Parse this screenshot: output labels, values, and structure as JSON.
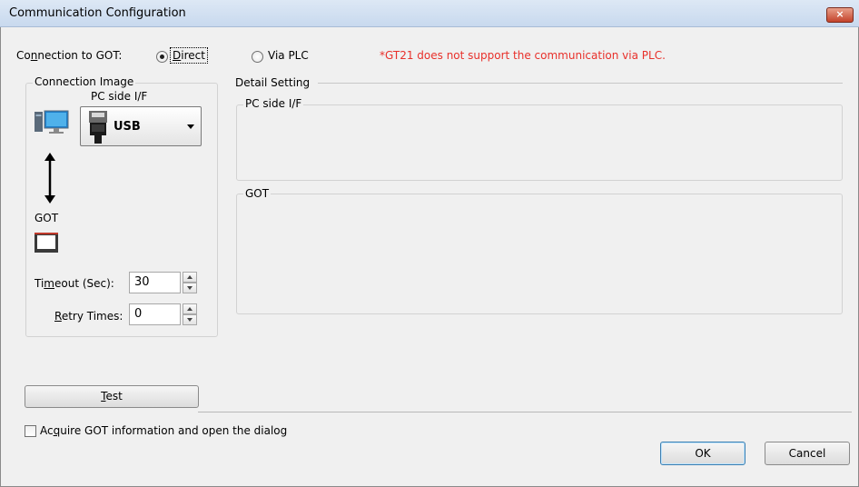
{
  "window": {
    "title": "Communication Configuration",
    "close_glyph": "×"
  },
  "connection": {
    "label_pre": "Co",
    "label_u": "n",
    "label_post": "nection to GOT:",
    "direct_pre": "",
    "direct_u": "D",
    "direct_post": "irect",
    "via_plc_label": "Via PLC",
    "selected": "Direct",
    "note": "*GT21 does not support the communication via PLC."
  },
  "connection_image": {
    "title": "Connection Image",
    "pc_side_label": "PC side I/F",
    "interface_value": "USB",
    "got_label": "GOT"
  },
  "timeout": {
    "label_pre": "Ti",
    "label_u": "m",
    "label_post": "eout (Sec):",
    "value": "30"
  },
  "retry": {
    "label_pre": "",
    "label_u": "R",
    "label_post": "etry Times:",
    "value": "0"
  },
  "detail": {
    "title": "Detail Setting",
    "pc_side_title": "PC side I/F",
    "got_title": "GOT"
  },
  "test_button": {
    "label_u": "T",
    "label_post": "est"
  },
  "acquire": {
    "label_pre": "Ac",
    "label_u": "q",
    "label_post": "uire GOT information and open the dialog",
    "checked": false
  },
  "ok_label": "OK",
  "cancel_label": "Cancel",
  "colors": {
    "note_red": "#e8302a",
    "title_bar": "#c8d9ee",
    "close_button": "#c4432b"
  }
}
